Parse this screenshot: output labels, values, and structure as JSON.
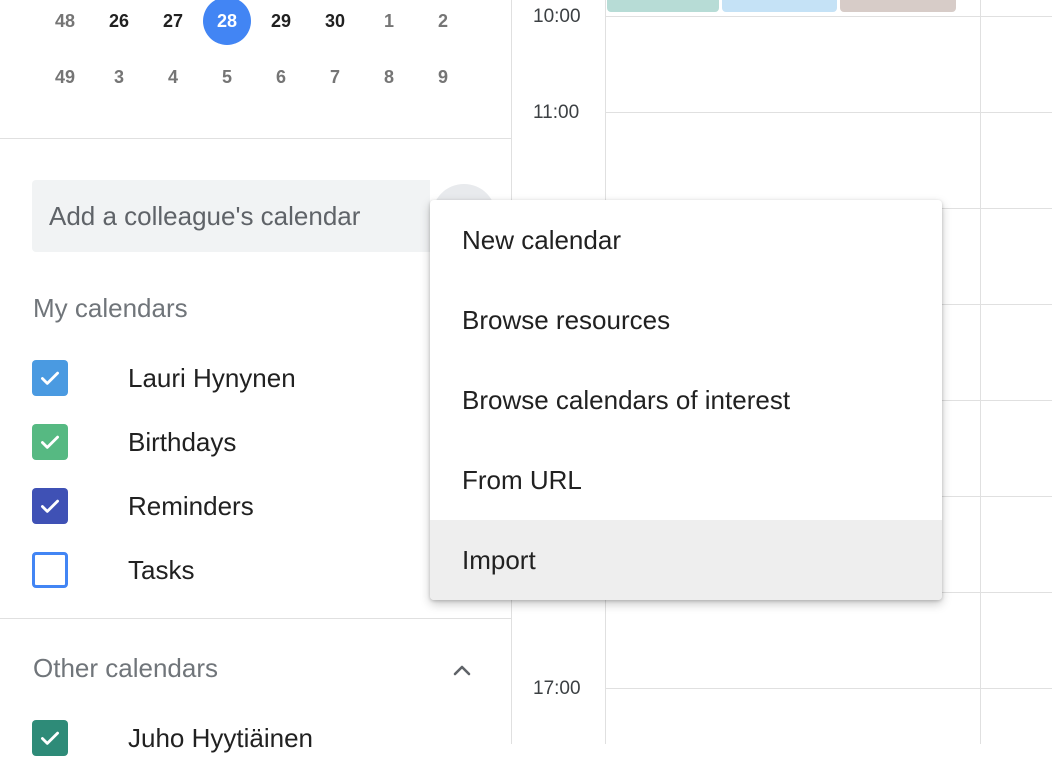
{
  "mini_calendar": {
    "rows": [
      {
        "week": "48",
        "days": [
          "26",
          "27",
          "28",
          "29",
          "30",
          "1",
          "2"
        ]
      },
      {
        "week": "49",
        "days": [
          "3",
          "4",
          "5",
          "6",
          "7",
          "8",
          "9"
        ]
      }
    ],
    "today": "28"
  },
  "add_calendar": {
    "placeholder": "Add a colleague's calendar"
  },
  "my_calendars": {
    "title": "My calendars",
    "items": [
      {
        "label": "Lauri Hynynen",
        "checked": true,
        "color": "#4a9ae1"
      },
      {
        "label": "Birthdays",
        "checked": true,
        "color": "#56b982"
      },
      {
        "label": "Reminders",
        "checked": true,
        "color": "#3f51b5"
      },
      {
        "label": "Tasks",
        "checked": false,
        "color": "#4285f4"
      }
    ]
  },
  "other_calendars": {
    "title": "Other calendars",
    "items": [
      {
        "label": "Juho Hyytiäinen",
        "checked": true,
        "color": "#2e8b78"
      }
    ]
  },
  "time_labels": [
    "10:00",
    "11:00",
    "17:00"
  ],
  "event_colors": [
    "#b7dcd6",
    "#c5e2f6",
    "#d7ccc8"
  ],
  "menu": {
    "items": [
      {
        "label": "New calendar"
      },
      {
        "label": "Browse resources"
      },
      {
        "label": "Browse calendars of interest"
      },
      {
        "label": "From URL"
      },
      {
        "label": "Import",
        "highlighted": true
      }
    ]
  }
}
